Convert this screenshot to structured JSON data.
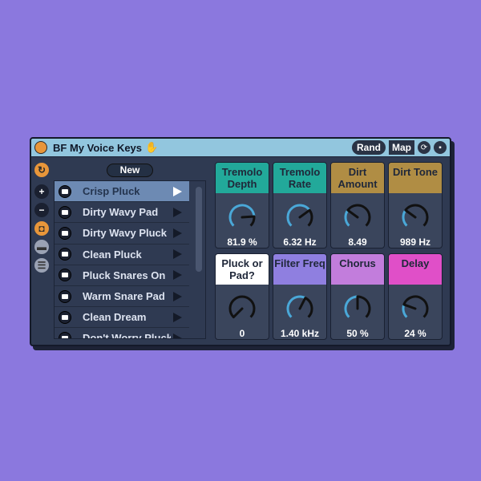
{
  "title": "BF My Voice Keys",
  "header_buttons": {
    "rand": "Rand",
    "map": "Map"
  },
  "new_label": "New",
  "presets": [
    {
      "name": "Crisp Pluck",
      "selected": true
    },
    {
      "name": "Dirty Wavy Pad"
    },
    {
      "name": "Dirty Wavy Pluck"
    },
    {
      "name": "Clean Pluck"
    },
    {
      "name": "Pluck Snares On"
    },
    {
      "name": "Warm Snare Pad"
    },
    {
      "name": "Clean Dream"
    },
    {
      "name": "Don't Worry Pluck"
    }
  ],
  "macros": [
    {
      "label": "Tremolo Depth",
      "value": "81.9 %",
      "fraction": 0.82,
      "color": "#22a99a"
    },
    {
      "label": "Tremolo Rate",
      "value": "6.32 Hz",
      "fraction": 0.7,
      "color": "#22a99a"
    },
    {
      "label": "Dirt Amount",
      "value": "8.49",
      "fraction": 0.3,
      "color": "#b08d44"
    },
    {
      "label": "Dirt Tone",
      "value": "989 Hz",
      "fraction": 0.3,
      "color": "#b08d44"
    },
    {
      "label": "Pluck or Pad?",
      "value": "0",
      "fraction": 0,
      "color": "#ffffff"
    },
    {
      "label": "Filter Freq",
      "value": "1.40 kHz",
      "fraction": 0.6,
      "color": "#8f7fe0"
    },
    {
      "label": "Chorus",
      "value": "50 %",
      "fraction": 0.5,
      "color": "#c27ddc"
    },
    {
      "label": "Delay",
      "value": "24 %",
      "fraction": 0.24,
      "color": "#e04fc8"
    }
  ]
}
